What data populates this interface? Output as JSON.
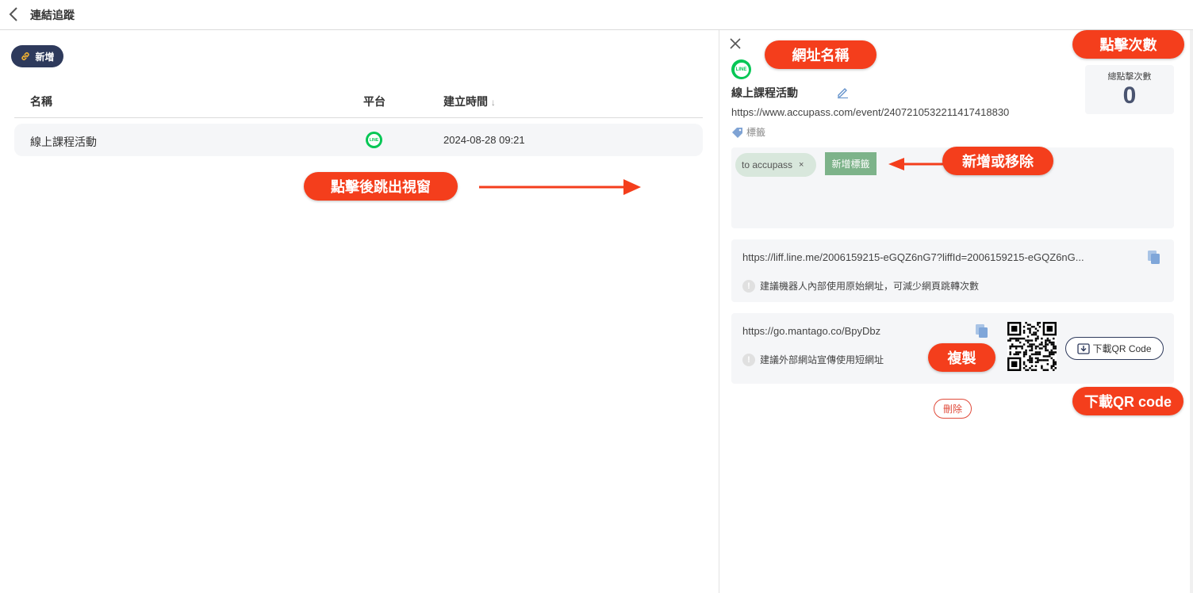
{
  "header": {
    "title": "連結追蹤"
  },
  "left": {
    "add_label": "新增",
    "columns": {
      "name": "名稱",
      "platform": "平台",
      "created": "建立時間",
      "sort_icon": "↓"
    },
    "rows": [
      {
        "name": "線上課程活動",
        "platform_icon": "line-icon",
        "created": "2024-08-28 09:21"
      }
    ]
  },
  "panel": {
    "line_badge": "LINE",
    "name": "線上課程活動",
    "original_url": "https://www.accupass.com/event/2407210532211417418830",
    "tag_label": "標籤",
    "click_count_label": "總點擊次數",
    "click_count": "0",
    "tags": [
      {
        "label": "to accupass",
        "remove": "×"
      }
    ],
    "add_tag_label": "新增標籤",
    "liff_url": "https://liff.line.me/2006159215-eGQZ6nG7?liffId=2006159215-eGQZ6nG...",
    "liff_hint": "建議機器人內部使用原始網址，可減少網頁跳轉次數",
    "short_url": "https://go.mantago.co/BpyDbz",
    "short_hint": "建議外部網站宣傳使用短網址",
    "download_label": "下載QR Code",
    "delete_label": "刪除"
  },
  "annotations": {
    "url_name": "網址名稱",
    "click_count": "點擊次數",
    "add_remove": "新增或移除",
    "popup": "點擊後跳出視窗",
    "copy": "複製",
    "download_qr": "下載QR code"
  },
  "colors": {
    "accent": "#2e3a5c",
    "line_green": "#06c755",
    "callout": "#f43e1c",
    "danger": "#e04a3a",
    "tag_green": "#7db38a"
  }
}
